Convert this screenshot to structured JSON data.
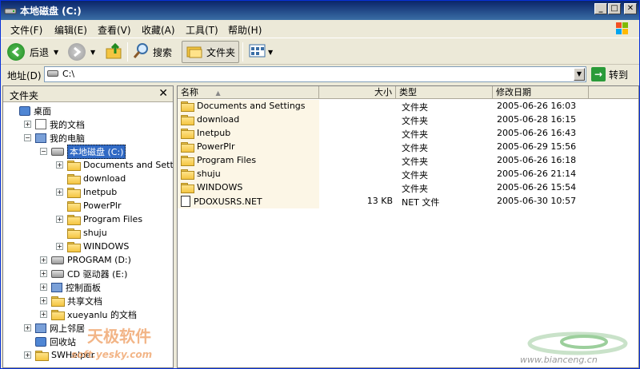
{
  "window": {
    "title": "本地磁盘 (C:)",
    "controls": {
      "minimize": "_",
      "maximize": "□",
      "close": "✕"
    }
  },
  "menu": [
    "文件(F)",
    "编辑(E)",
    "查看(V)",
    "收藏(A)",
    "工具(T)",
    "帮助(H)"
  ],
  "toolbar": {
    "back": "后退",
    "search": "搜索",
    "folders": "文件夹"
  },
  "address": {
    "label": "地址(D)",
    "value": "C:\\",
    "go": "转到"
  },
  "folder_pane": {
    "title": "文件夹",
    "close": "✕",
    "tree": [
      {
        "label": "桌面",
        "depth": 0,
        "icon": "desktop-icon",
        "expander": ""
      },
      {
        "label": "我的文档",
        "depth": 1,
        "icon": "my-documents-icon",
        "expander": "+"
      },
      {
        "label": "我的电脑",
        "depth": 1,
        "icon": "my-computer-icon",
        "expander": "−"
      },
      {
        "label": "本地磁盘 (C:)",
        "depth": 2,
        "icon": "drive-icon",
        "expander": "−",
        "selected": true
      },
      {
        "label": "Documents and Settings",
        "depth": 3,
        "icon": "folder-icon",
        "expander": "+"
      },
      {
        "label": "download",
        "depth": 3,
        "icon": "folder-icon",
        "expander": ""
      },
      {
        "label": "Inetpub",
        "depth": 3,
        "icon": "folder-icon",
        "expander": "+"
      },
      {
        "label": "PowerPlr",
        "depth": 3,
        "icon": "folder-icon",
        "expander": ""
      },
      {
        "label": "Program Files",
        "depth": 3,
        "icon": "folder-icon",
        "expander": "+"
      },
      {
        "label": "shuju",
        "depth": 3,
        "icon": "folder-icon",
        "expander": ""
      },
      {
        "label": "WINDOWS",
        "depth": 3,
        "icon": "folder-icon",
        "expander": "+"
      },
      {
        "label": "PROGRAM (D:)",
        "depth": 2,
        "icon": "drive-icon",
        "expander": "+"
      },
      {
        "label": "CD 驱动器 (E:)",
        "depth": 2,
        "icon": "cd-drive-icon",
        "expander": "+"
      },
      {
        "label": "控制面板",
        "depth": 2,
        "icon": "control-panel-icon",
        "expander": "+"
      },
      {
        "label": "共享文档",
        "depth": 2,
        "icon": "folder-icon",
        "expander": "+"
      },
      {
        "label": "xueyanlu 的文档",
        "depth": 2,
        "icon": "folder-icon",
        "expander": "+"
      },
      {
        "label": "网上邻居",
        "depth": 1,
        "icon": "network-icon",
        "expander": "+"
      },
      {
        "label": "回收站",
        "depth": 1,
        "icon": "recycle-bin-icon",
        "expander": ""
      },
      {
        "label": "SWHelper",
        "depth": 1,
        "icon": "folder-icon",
        "expander": "+"
      }
    ]
  },
  "columns": {
    "name": "名称",
    "size": "大小",
    "type": "类型",
    "modified": "修改日期"
  },
  "files": [
    {
      "name": "Documents and Settings",
      "size": "",
      "type": "文件夹",
      "modified": "2005-06-26 16:03",
      "icon": "folder-icon"
    },
    {
      "name": "download",
      "size": "",
      "type": "文件夹",
      "modified": "2005-06-28 16:15",
      "icon": "folder-icon"
    },
    {
      "name": "Inetpub",
      "size": "",
      "type": "文件夹",
      "modified": "2005-06-26 16:43",
      "icon": "folder-icon"
    },
    {
      "name": "PowerPlr",
      "size": "",
      "type": "文件夹",
      "modified": "2005-06-29 15:56",
      "icon": "folder-icon"
    },
    {
      "name": "Program Files",
      "size": "",
      "type": "文件夹",
      "modified": "2005-06-26 16:18",
      "icon": "folder-icon"
    },
    {
      "name": "shuju",
      "size": "",
      "type": "文件夹",
      "modified": "2005-06-26 21:14",
      "icon": "folder-icon"
    },
    {
      "name": "WINDOWS",
      "size": "",
      "type": "文件夹",
      "modified": "2005-06-26 15:54",
      "icon": "folder-icon"
    },
    {
      "name": "PDOXUSRS.NET",
      "size": "13 KB",
      "type": "NET 文件",
      "modified": "2005-06-30 10:57",
      "icon": "file-icon"
    }
  ],
  "watermarks": {
    "left_main": "天极软件",
    "left_url": "soft.yesky.com",
    "right_url": "www.bianceng.cn"
  }
}
